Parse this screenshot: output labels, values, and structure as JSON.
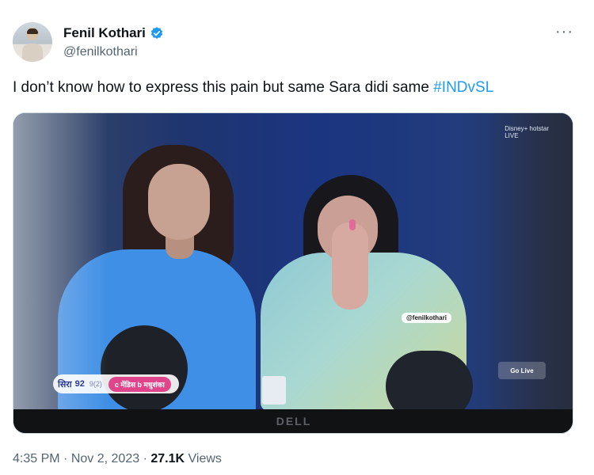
{
  "author": {
    "display_name": "Fenil Kothari",
    "handle": "@fenilkothari",
    "verified": true
  },
  "tweet": {
    "text": "I don’t know how to express this pain but same Sara didi same",
    "hashtag": "#INDvSL"
  },
  "media": {
    "broadcaster_line1": "Disney+ hotstar",
    "broadcaster_line2": "LIVE",
    "watermark": "@fenilkothari",
    "go_live_label": "Go Live",
    "score_prefix": "सिरा",
    "score": "92",
    "score_extra": "9(2)",
    "batter_text": "c मेंडिस b मधुशंका",
    "monitor_brand": "DELL"
  },
  "meta": {
    "time": "4:35 PM",
    "date": "Nov 2, 2023",
    "separator": "·",
    "views_count": "27.1K",
    "views_label": "Views"
  },
  "menu_icon_glyph": "···",
  "colors": {
    "accent": "#1d9bf0",
    "text": "#0f1419",
    "secondary_text": "#536471"
  }
}
